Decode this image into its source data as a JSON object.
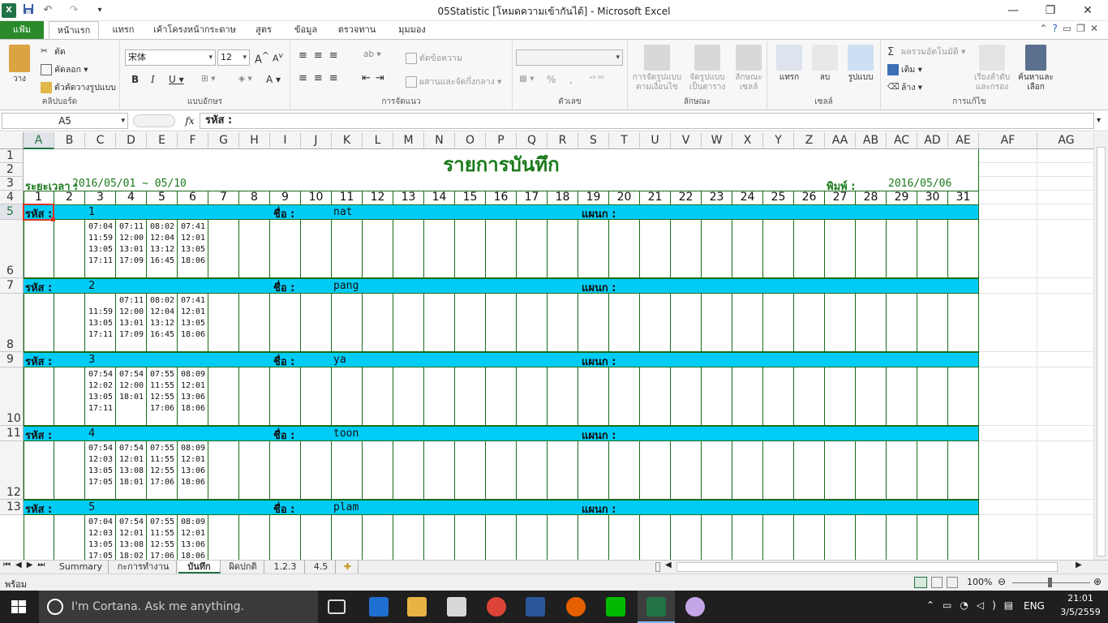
{
  "window": {
    "title": "05Statistic  [โหมดความเข้ากันได้] - Microsoft Excel"
  },
  "tabs": {
    "file": "แฟ้ม",
    "items": [
      "หน้าแรก",
      "แทรก",
      "เค้าโครงหน้ากระดาษ",
      "สูตร",
      "ข้อมูล",
      "ตรวจทาน",
      "มุมมอง"
    ]
  },
  "ribbon": {
    "clipboard": {
      "paste": "วาง",
      "cut": "ตัด",
      "copy": "คัดลอก",
      "format_painter": "ตัวคัดวางรูปแบบ",
      "label": "คลิปบอร์ด"
    },
    "font": {
      "name": "宋体",
      "size": "12",
      "label": "แบบอักษร"
    },
    "alignment": {
      "wrap": "ตัดข้อความ",
      "merge": "ผสานและจัดกึ่งกลาง",
      "label": "การจัดแนว"
    },
    "number": {
      "format": "",
      "percent": "%",
      "comma": ",",
      "label": "ตัวเลข"
    },
    "styles": {
      "cond": "การจัดรูปแบบตามเงื่อนไข",
      "table": "จัดรูปแบบเป็นตาราง",
      "cell": "ลักษณะเซลล์",
      "label": "ลักษณะ"
    },
    "cells": {
      "insert": "แทรก",
      "delete": "ลบ",
      "format": "รูปแบบ",
      "label": "เซลล์"
    },
    "editing": {
      "autosum": "ผลรวมอัตโนมัติ",
      "fill": "เติม",
      "clear": "ล้าง",
      "sort": "เรียงลำดับและกรอง",
      "find": "ค้นหาและเลือก",
      "label": "การแก้ไข"
    }
  },
  "formula": {
    "cell_ref": "A5",
    "content": "รหัส :"
  },
  "sheet": {
    "columns": [
      "A",
      "B",
      "C",
      "D",
      "E",
      "F",
      "G",
      "H",
      "I",
      "J",
      "K",
      "L",
      "M",
      "N",
      "O",
      "P",
      "Q",
      "R",
      "S",
      "T",
      "U",
      "V",
      "W",
      "X",
      "Y",
      "Z",
      "AA",
      "AB",
      "AC",
      "AD",
      "AE",
      "AF",
      "AG"
    ],
    "rows": [
      "1",
      "2",
      "3",
      "4",
      "5",
      "6",
      "7",
      "8",
      "9",
      "10",
      "11",
      "12",
      "13"
    ],
    "title": "รายการบันทึก",
    "period_label": "ระยะเวลา :",
    "period_value": "2016/05/01 ~ 05/10",
    "print_label": "พิมพ์ :",
    "print_date": "2016/05/06",
    "days": [
      "1",
      "2",
      "3",
      "4",
      "5",
      "6",
      "7",
      "8",
      "9",
      "10",
      "11",
      "12",
      "13",
      "14",
      "15",
      "16",
      "17",
      "18",
      "19",
      "20",
      "21",
      "22",
      "23",
      "24",
      "25",
      "26",
      "27",
      "28",
      "29",
      "30",
      "31"
    ],
    "id_label": "รหัส :",
    "name_label": "ชื่อ :",
    "dept_label": "แผนก :",
    "employees": [
      {
        "id": "1",
        "name": "nat",
        "days": [
          [],
          [],
          [
            "07:04",
            "11:59",
            "13:05",
            "17:11"
          ],
          [
            "07:11",
            "12:00",
            "13:01",
            "17:09"
          ],
          [
            "08:02",
            "12:04",
            "13:12",
            "16:45"
          ],
          [
            "07:41",
            "12:01",
            "13:05",
            "18:06"
          ]
        ]
      },
      {
        "id": "2",
        "name": "pang",
        "days": [
          [],
          [],
          [
            "",
            "11:59",
            "13:05",
            "17:11"
          ],
          [
            "07:11",
            "12:00",
            "13:01",
            "17:09"
          ],
          [
            "08:02",
            "12:04",
            "13:12",
            "16:45"
          ],
          [
            "07:41",
            "12:01",
            "13:05",
            "18:06"
          ]
        ]
      },
      {
        "id": "3",
        "name": "ya",
        "days": [
          [],
          [],
          [
            "07:54",
            "12:02",
            "13:05",
            "17:11"
          ],
          [
            "07:54",
            "12:00",
            "18:01",
            ""
          ],
          [
            "07:55",
            "11:55",
            "12:55",
            "17:06"
          ],
          [
            "08:09",
            "12:01",
            "13:06",
            "18:06"
          ]
        ]
      },
      {
        "id": "4",
        "name": "toon",
        "days": [
          [],
          [],
          [
            "07:54",
            "12:03",
            "13:05",
            "17:05"
          ],
          [
            "07:54",
            "12:01",
            "13:08",
            "18:01"
          ],
          [
            "07:55",
            "11:55",
            "12:55",
            "17:06"
          ],
          [
            "08:09",
            "12:01",
            "13:06",
            "18:06"
          ]
        ]
      },
      {
        "id": "5",
        "name": "plam",
        "days": [
          [],
          [],
          [
            "07:04",
            "12:03",
            "13:05",
            "17:05"
          ],
          [
            "07:54",
            "12:01",
            "13:08",
            "18:02"
          ],
          [
            "07:55",
            "11:55",
            "12:55",
            "17:06"
          ],
          [
            "08:09",
            "12:01",
            "13:06",
            "18:06"
          ]
        ]
      }
    ]
  },
  "sheet_tabs": {
    "items": [
      "Summary",
      "กะการทำงาน",
      "บันทึก",
      "ผิดปกติ",
      "1.2.3",
      "4.5"
    ],
    "active": "บันทึก"
  },
  "status": {
    "ready": "พร้อม",
    "zoom": "100%"
  },
  "taskbar": {
    "search_placeholder": "I'm Cortana. Ask me anything.",
    "lang": "ENG",
    "time": "21:01",
    "date": "3/5/2559"
  }
}
